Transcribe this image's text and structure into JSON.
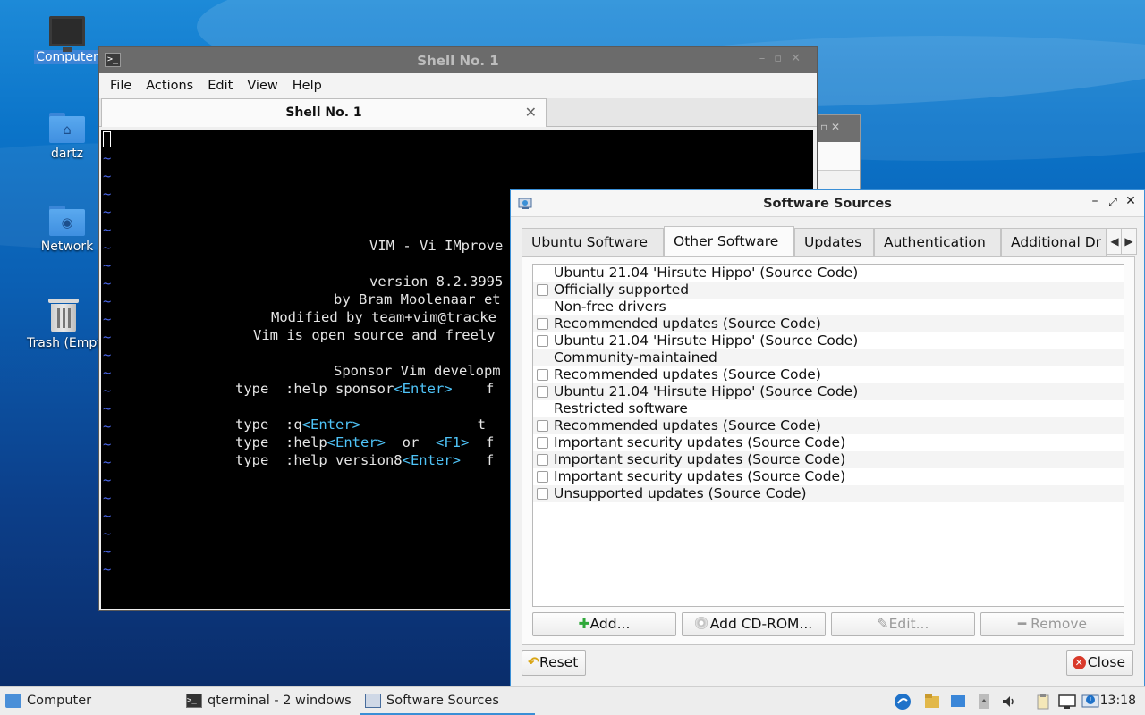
{
  "desktop": {
    "icons": [
      {
        "label": "Computer"
      },
      {
        "label": "dartz"
      },
      {
        "label": "Network"
      },
      {
        "label": "Trash (Empty)"
      }
    ]
  },
  "terminal": {
    "title": "Shell No. 1",
    "menu": [
      "File",
      "Actions",
      "Edit",
      "View",
      "Help"
    ],
    "tab_label": "Shell No. 1",
    "vim_lines": [
      "VIM - Vi IMprove",
      "version 8.2.3995",
      "by Bram Moolenaar et",
      "Modified by team+vim@tracke",
      "Vim is open source and freely",
      "Sponsor Vim developm",
      "type  :help sponsor",
      "<Enter>",
      "type  :q",
      "type  :help",
      "or",
      "<F1>",
      "type  :help version8"
    ]
  },
  "dialog": {
    "title": "Software Sources",
    "tabs": [
      "Ubuntu Software",
      "Other Software",
      "Updates",
      "Authentication",
      "Additional Dr"
    ],
    "active_tab": "Other Software",
    "list": [
      {
        "text": "Ubuntu 21.04 'Hirsute Hippo' (Source Code)",
        "checkbox": false
      },
      {
        "text": "Officially supported",
        "checkbox": true
      },
      {
        "text": "Non-free drivers",
        "checkbox": false
      },
      {
        "text": "Recommended updates (Source Code)",
        "checkbox": true
      },
      {
        "text": "Ubuntu 21.04 'Hirsute Hippo' (Source Code)",
        "checkbox": true
      },
      {
        "text": "Community-maintained",
        "checkbox": false
      },
      {
        "text": "Recommended updates (Source Code)",
        "checkbox": true
      },
      {
        "text": "Ubuntu 21.04 'Hirsute Hippo' (Source Code)",
        "checkbox": true
      },
      {
        "text": "Restricted software",
        "checkbox": false
      },
      {
        "text": "Recommended updates (Source Code)",
        "checkbox": true
      },
      {
        "text": "Important security updates (Source Code)",
        "checkbox": true
      },
      {
        "text": "Important security updates (Source Code)",
        "checkbox": true
      },
      {
        "text": "Important security updates (Source Code)",
        "checkbox": true
      },
      {
        "text": "Unsupported updates (Source Code)",
        "checkbox": true
      }
    ],
    "buttons": {
      "add": "Add...",
      "add_cdrom": "Add CD-ROM...",
      "edit": "Edit...",
      "remove": "Remove",
      "reset": "Reset",
      "close": "Close"
    }
  },
  "taskbar": {
    "items": [
      {
        "label": "Computer"
      },
      {
        "label": "qterminal - 2 windows"
      },
      {
        "label": "Software Sources"
      }
    ],
    "clock": "13:18"
  }
}
